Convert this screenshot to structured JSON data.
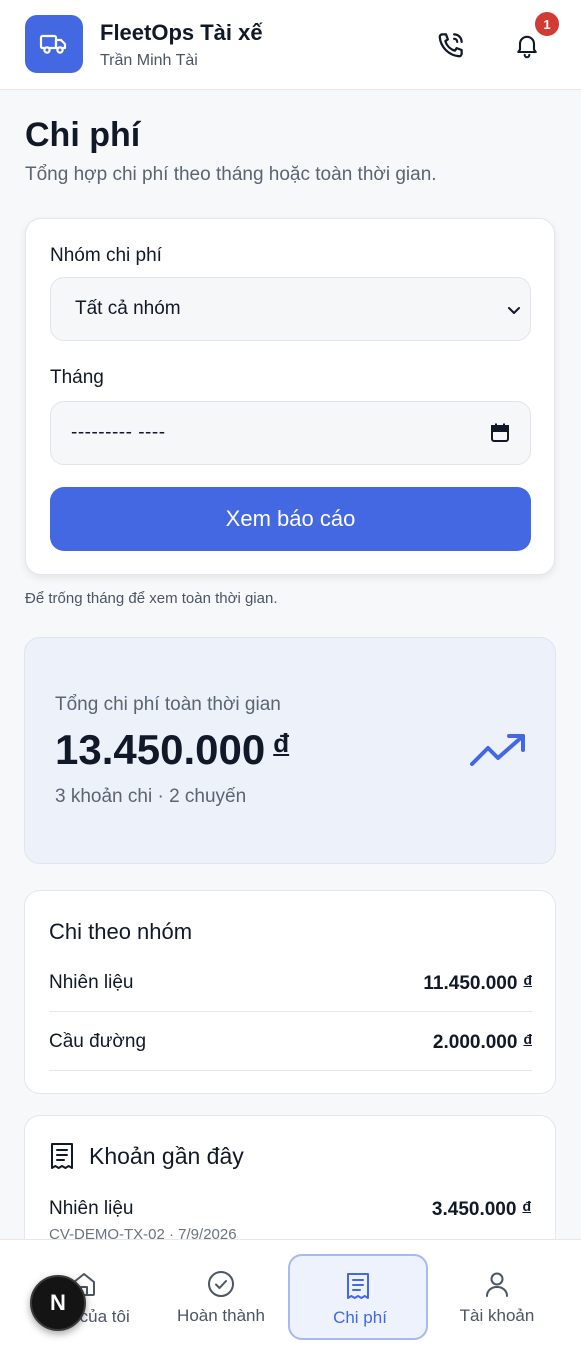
{
  "header": {
    "app_title": "FleetOps Tài xế",
    "user_name": "Trần Minh Tài",
    "notification_count": "1",
    "logo_icon": "truck-icon",
    "call_icon": "phone-icon",
    "bell_icon": "bell-icon"
  },
  "page": {
    "title": "Chi phí",
    "subtitle": "Tổng hợp chi phí theo tháng hoặc toàn thời gian."
  },
  "filter": {
    "group_label": "Nhóm chi phí",
    "group_value": "Tất cả nhóm",
    "month_label": "Tháng",
    "month_value": "--------- ----",
    "submit_label": "Xem báo cáo",
    "hint": "Để trống tháng để xem toàn thời gian."
  },
  "summary": {
    "label": "Tổng chi phí toàn thời gian",
    "amount": "13.450.000",
    "currency": "đ",
    "meta": "3 khoản chi · 2 chuyến",
    "icon": "trending-up-icon"
  },
  "by_group": {
    "title": "Chi theo nhóm",
    "rows": [
      {
        "name": "Nhiên liệu",
        "amount": "11.450.000",
        "currency": "đ"
      },
      {
        "name": "Cầu đường",
        "amount": "2.000.000",
        "currency": "đ"
      }
    ]
  },
  "recent": {
    "title": "Khoản gần đây",
    "icon": "receipt-icon",
    "items": [
      {
        "name": "Nhiên liệu",
        "amount": "3.450.000",
        "currency": "đ",
        "meta": "CV-DEMO-TX-02 · 7/9/2026"
      }
    ]
  },
  "nav": {
    "items": [
      {
        "label": "Việc của tôi",
        "icon": "home-icon",
        "visible_label": "iên của tôi"
      },
      {
        "label": "Hoàn thành",
        "icon": "check-circle-icon"
      },
      {
        "label": "Chi phí",
        "icon": "receipt-icon",
        "active": true
      },
      {
        "label": "Tài khoản",
        "icon": "user-icon"
      }
    ],
    "fab_letter": "N"
  },
  "colors": {
    "brand": "#4467e2",
    "badge": "#d23b34",
    "summary_bg": "#edf1fa"
  }
}
